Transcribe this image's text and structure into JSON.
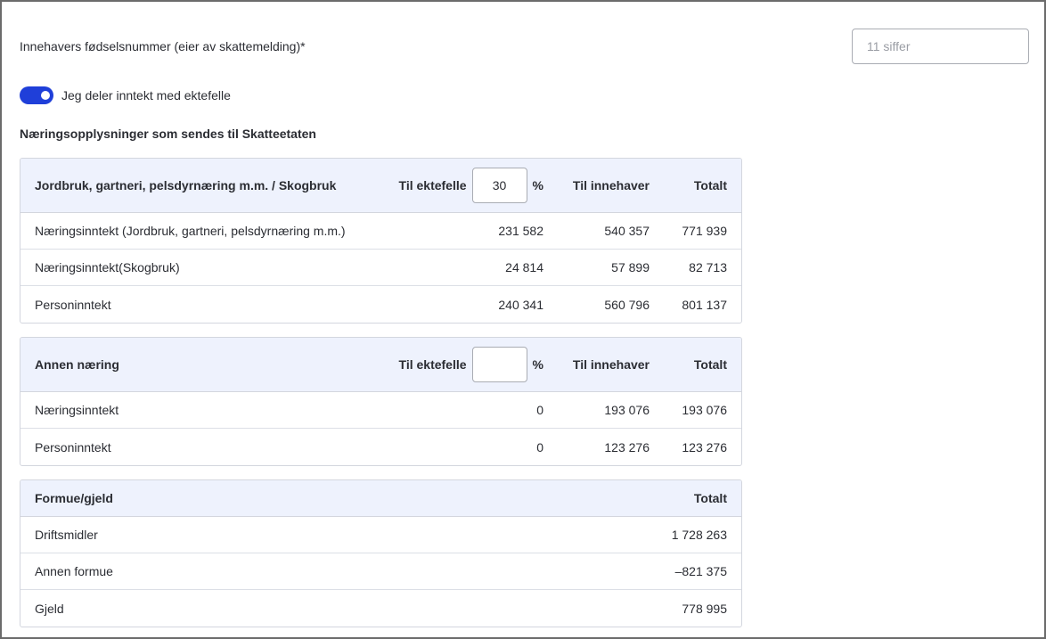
{
  "owner": {
    "label": "Innehavers fødselsnummer (eier av skattemelding)*",
    "placeholder": "11 siffer",
    "value": ""
  },
  "share_toggle": {
    "label": "Jeg deler inntekt med ektefelle",
    "on": true
  },
  "section_title": "Næringsopplysninger som sendes til Skatteetaten",
  "colors": {
    "accent": "#1f3fd9",
    "header_bg": "#eef2fd",
    "border": "#d3d6de"
  },
  "tables": [
    {
      "title": "Jordbruk, gartneri, pelsdyrnæring m.m. / Skogbruk",
      "col_spouse": "Til ektefelle",
      "spouse_pct": "30",
      "pct_sign": "%",
      "col_owner": "Til innehaver",
      "col_total": "Totalt",
      "rows": [
        {
          "label": "Næringsinntekt (Jordbruk, gartneri, pelsdyrnæring m.m.)",
          "spouse": "231 582",
          "owner": "540 357",
          "total": "771 939"
        },
        {
          "label": "Næringsinntekt(Skogbruk)",
          "spouse": "24 814",
          "owner": "57 899",
          "total": "82 713"
        },
        {
          "label": "Personinntekt",
          "spouse": "240 341",
          "owner": "560 796",
          "total": "801 137"
        }
      ]
    },
    {
      "title": "Annen næring",
      "col_spouse": "Til ektefelle",
      "spouse_pct": "",
      "pct_sign": "%",
      "col_owner": "Til innehaver",
      "col_total": "Totalt",
      "rows": [
        {
          "label": "Næringsinntekt",
          "spouse": "0",
          "owner": "193 076",
          "total": "193 076"
        },
        {
          "label": "Personinntekt",
          "spouse": "0",
          "owner": "123 276",
          "total": "123 276"
        }
      ]
    }
  ],
  "wealth": {
    "title": "Formue/gjeld",
    "col_total": "Totalt",
    "rows": [
      {
        "label": "Driftsmidler",
        "total": "1 728 263"
      },
      {
        "label": "Annen formue",
        "total": "–821 375"
      },
      {
        "label": "Gjeld",
        "total": "778 995"
      }
    ]
  }
}
